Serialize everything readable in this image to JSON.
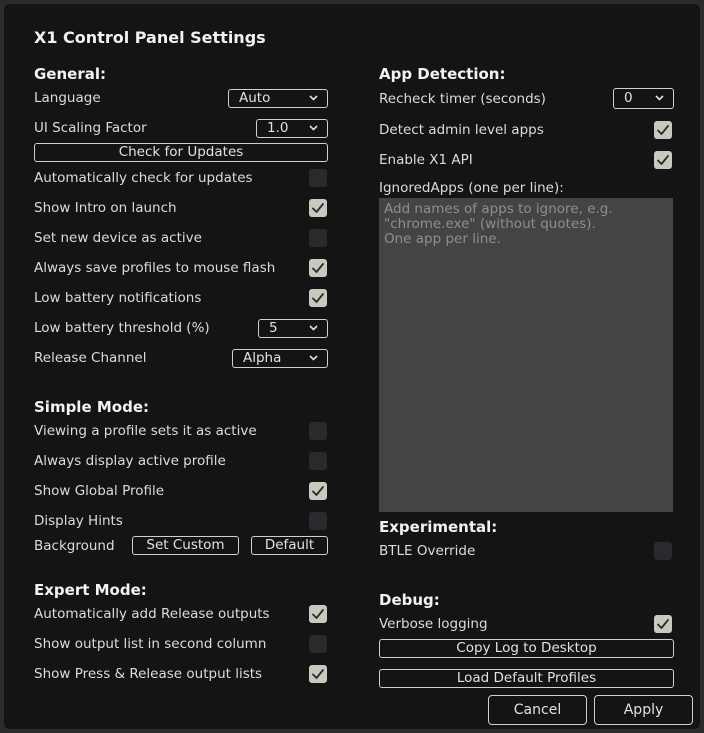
{
  "title": "X1 Control Panel Settings",
  "general": {
    "heading": "General:",
    "language_label": "Language",
    "language_value": "Auto",
    "ui_scaling_label": "UI Scaling Factor",
    "ui_scaling_value": "1.0",
    "check_updates_button": "Check for Updates",
    "auto_check_label": "Automatically check for updates",
    "auto_check_checked": false,
    "show_intro_label": "Show Intro on launch",
    "show_intro_checked": true,
    "set_device_label": "Set new device as active",
    "set_device_checked": false,
    "save_profiles_label": "Always save profiles to mouse flash",
    "save_profiles_checked": true,
    "low_battery_notif_label": "Low battery notifications",
    "low_battery_notif_checked": true,
    "low_battery_threshold_label": "Low battery threshold (%)",
    "low_battery_threshold_value": "5",
    "release_channel_label": "Release Channel",
    "release_channel_value": "Alpha"
  },
  "simple_mode": {
    "heading": "Simple Mode:",
    "viewing_profile_label": "Viewing a profile sets it as active",
    "viewing_profile_checked": false,
    "display_active_label": "Always display active profile",
    "display_active_checked": false,
    "show_global_label": "Show Global Profile",
    "show_global_checked": true,
    "display_hints_label": "Display Hints",
    "display_hints_checked": false,
    "background_label": "Background",
    "set_custom_button": "Set Custom",
    "default_button": "Default"
  },
  "expert_mode": {
    "heading": "Expert Mode:",
    "auto_release_label": "Automatically add Release outputs",
    "auto_release_checked": true,
    "second_column_label": "Show output list in second column",
    "second_column_checked": false,
    "press_release_label": "Show Press & Release output lists",
    "press_release_checked": true
  },
  "app_detection": {
    "heading": "App Detection:",
    "recheck_label": "Recheck timer (seconds)",
    "recheck_value": "0",
    "detect_admin_label": "Detect admin level apps",
    "detect_admin_checked": true,
    "enable_api_label": "Enable X1 API",
    "enable_api_checked": true,
    "ignored_apps_label": "IgnoredApps (one per line):",
    "ignored_apps_placeholder": "Add names of apps to ignore, e.g.\n\"chrome.exe\" (without quotes).\nOne app per line."
  },
  "experimental": {
    "heading": "Experimental:",
    "btle_label": "BTLE Override",
    "btle_checked": false
  },
  "debug": {
    "heading": "Debug:",
    "verbose_label": "Verbose logging",
    "verbose_checked": true,
    "copy_log_button": "Copy Log to Desktop",
    "load_defaults_button": "Load Default Profiles"
  },
  "footer": {
    "cancel_button": "Cancel",
    "apply_button": "Apply"
  },
  "icons": {
    "checkmark": "checkmark-icon",
    "dropdown": "chevron-down-icon"
  },
  "colors": {
    "background": "#141414",
    "checkbox_checked": "#c9c9c0",
    "checkbox_unchecked": "#2a2a2e",
    "textarea": "#444444"
  }
}
